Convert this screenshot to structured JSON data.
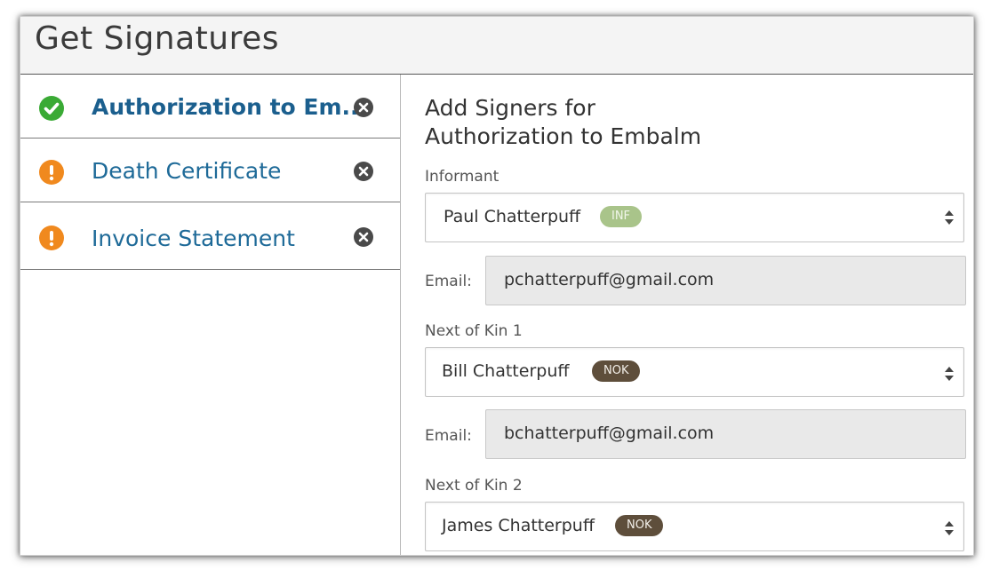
{
  "header": {
    "title": "Get Signatures"
  },
  "documents": [
    {
      "label": "Authorization to Em...",
      "status": "complete",
      "status_icon": "check-circle-icon",
      "status_color": "#3aaa35",
      "active": true
    },
    {
      "label": "Death Certificate",
      "status": "warning",
      "status_icon": "exclamation-circle-icon",
      "status_color": "#f0891e",
      "active": false
    },
    {
      "label": "Invoice Statement",
      "status": "warning",
      "status_icon": "exclamation-circle-icon",
      "status_color": "#f0891e",
      "active": false
    }
  ],
  "main": {
    "heading_line1": "Add Signers for",
    "heading_line2": "Authorization to Embalm",
    "signers": [
      {
        "role_label": "Informant",
        "name": "Paul Chatterpuff",
        "badge": "INF",
        "email_label": "Email:",
        "email": "pchatterpuff@gmail.com"
      },
      {
        "role_label": "Next of Kin 1",
        "name": "Bill Chatterpuff",
        "badge": "NOK",
        "email_label": "Email:",
        "email": "bchatterpuff@gmail.com"
      },
      {
        "role_label": "Next of Kin 2",
        "name": "James Chatterpuff",
        "badge": "NOK"
      }
    ]
  },
  "colors": {
    "link": "#1e6a98",
    "inf_badge": "#a9c48a",
    "nok_badge": "#5e4e3b",
    "complete": "#3aaa35",
    "warning": "#f0891e"
  }
}
